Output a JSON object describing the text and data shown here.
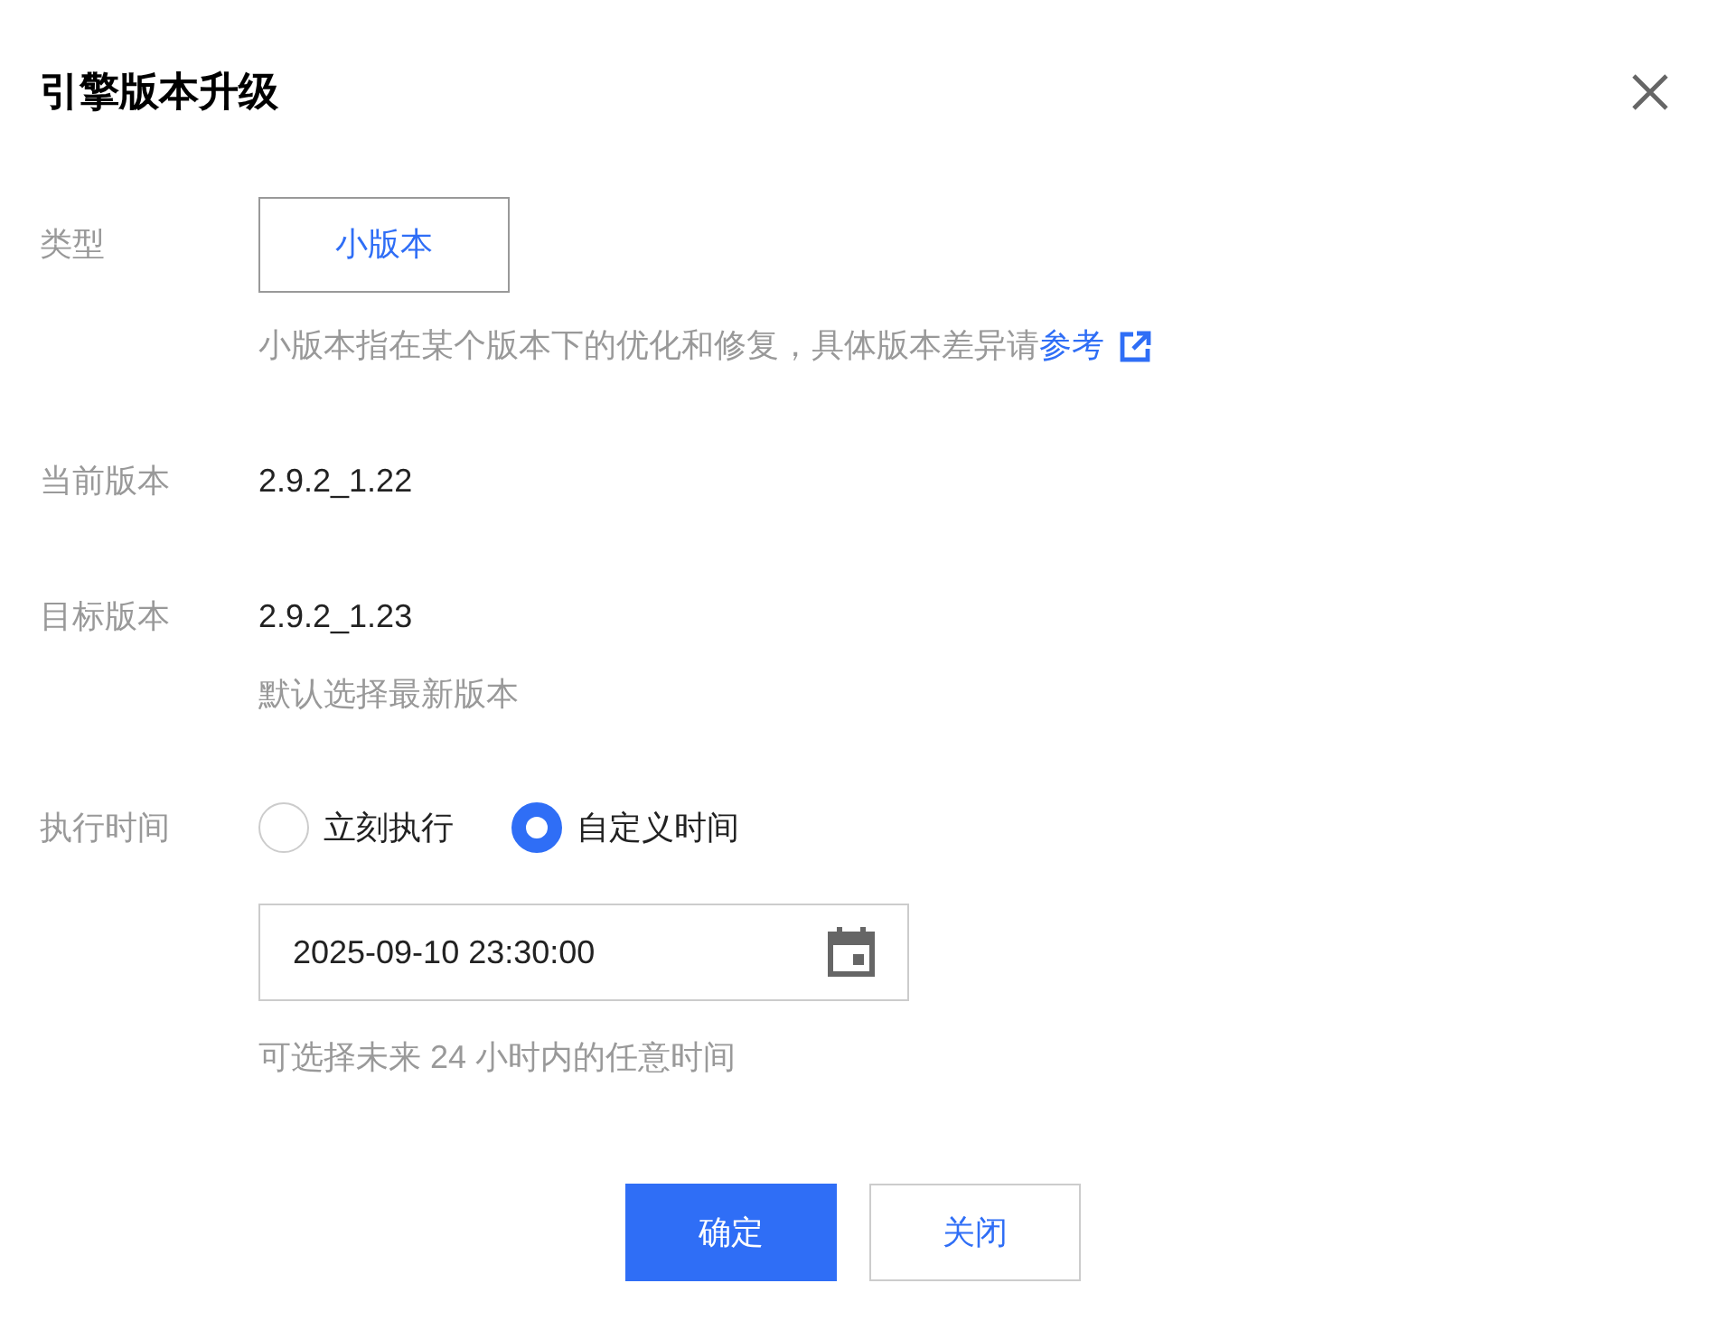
{
  "dialog": {
    "title": "引擎版本升级"
  },
  "type": {
    "label": "类型",
    "options": [
      {
        "label": "小版本",
        "selected": true
      }
    ],
    "hint": "小版本指在某个版本下的优化和修复，具体版本差异请",
    "link": "参考"
  },
  "current_version": {
    "label": "当前版本",
    "value": "2.9.2_1.22"
  },
  "target_version": {
    "label": "目标版本",
    "value": "2.9.2_1.23",
    "hint": "默认选择最新版本"
  },
  "execution_time": {
    "label": "执行时间",
    "options": [
      {
        "label": "立刻执行",
        "selected": false
      },
      {
        "label": "自定义时间",
        "selected": true
      }
    ],
    "value": "2025-09-10 23:30:00",
    "hint": "可选择未来 24 小时内的任意时间"
  },
  "buttons": [
    {
      "label": "确定",
      "kind": "primary"
    },
    {
      "label": "关闭",
      "kind": "secondary"
    }
  ]
}
